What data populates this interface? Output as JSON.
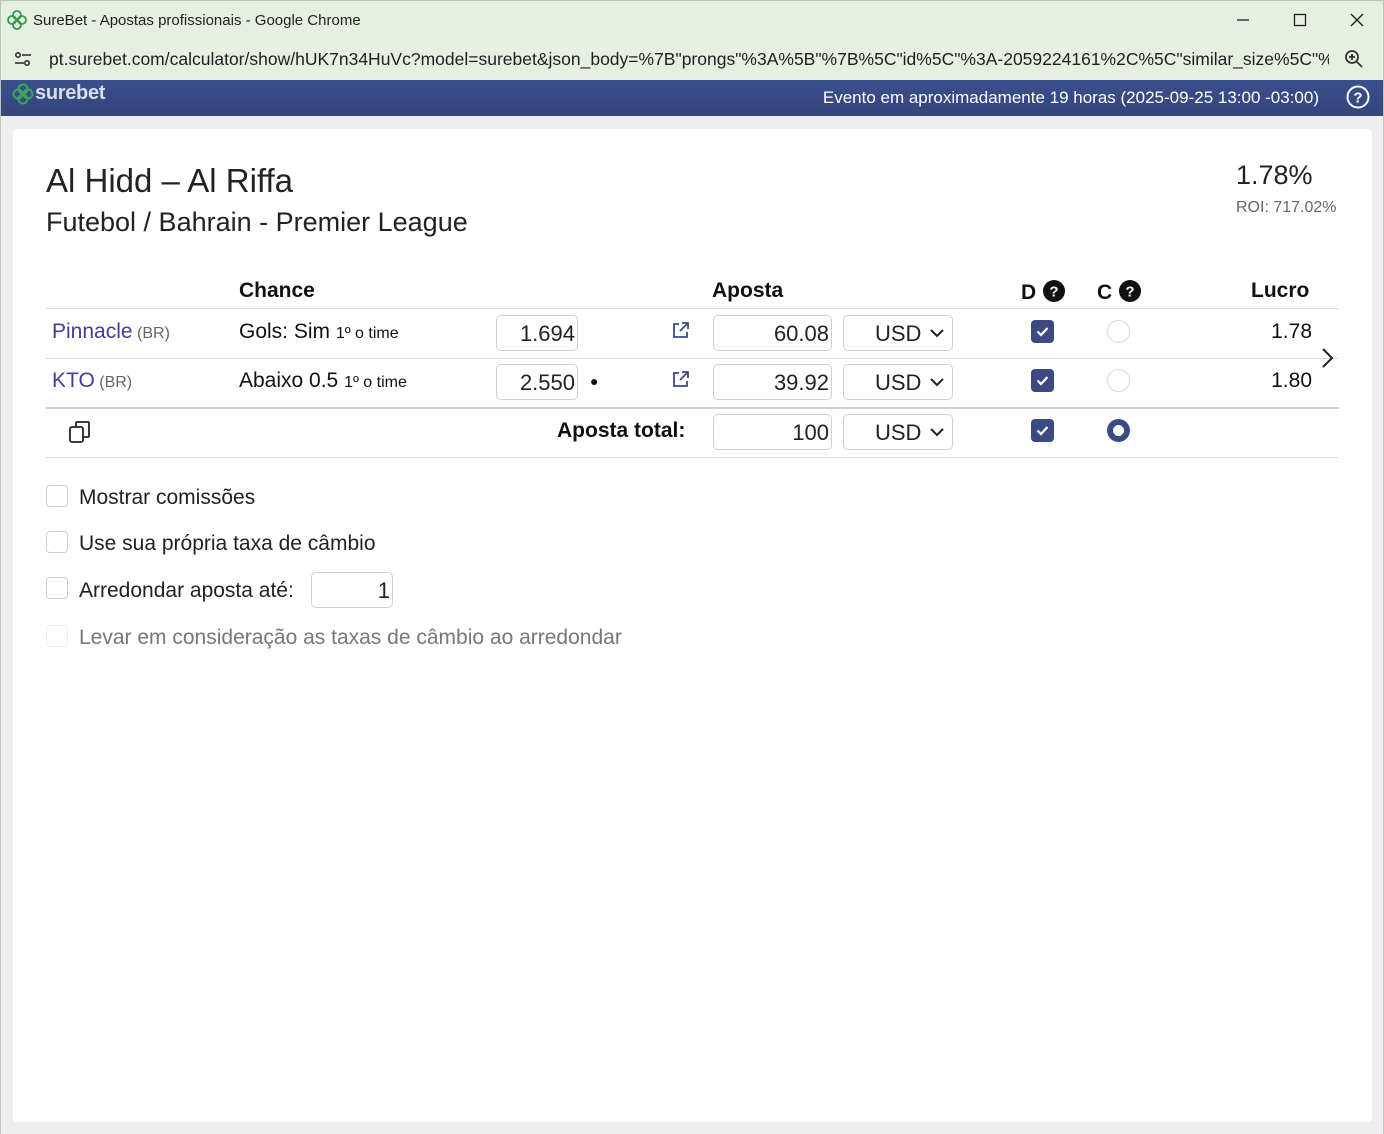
{
  "window": {
    "title": "SureBet - Apostas profissionais - Google Chrome",
    "url": "pt.surebet.com/calculator/show/hUK7n34HuVc?model=surebet&json_body=%7B\"prongs\"%3A%5B\"%7B%5C\"id%5C\"%3A-2059224161%2C%5C\"similar_size%5C\"%3..."
  },
  "header": {
    "logo_text": "surebet",
    "event_info": "Evento em aproximadamente 19 horas (2025-09-25 13:00 -03:00)"
  },
  "match": {
    "title": "Al Hidd – Al Riffa",
    "subtitle": "Futebol / Bahrain - Premier League",
    "profit_percent": "1.78%",
    "roi": "ROI: 717.02%"
  },
  "table": {
    "headers": {
      "chance": "Chance",
      "aposta": "Aposta",
      "d": "D",
      "c": "C",
      "lucro": "Lucro"
    },
    "rows": [
      {
        "bookmaker": "Pinnacle",
        "region": "(BR)",
        "outcome": "Gols: Sim",
        "period": "1º o time",
        "odds": "1.694",
        "stake": "60.08",
        "currency": "USD",
        "profit": "1.78",
        "d_checked": true,
        "c_selected": false
      },
      {
        "bookmaker": "KTO",
        "region": "(BR)",
        "outcome": "Abaixo 0.5",
        "period": "1º o time",
        "odds": "2.550",
        "odds_marker": "●",
        "stake": "39.92",
        "currency": "USD",
        "profit": "1.80",
        "d_checked": true,
        "c_selected": false
      }
    ],
    "total": {
      "label": "Aposta total:",
      "stake": "100",
      "currency": "USD",
      "d_checked": true,
      "c_selected": true
    }
  },
  "options": {
    "show_commissions": "Mostrar comissões",
    "own_exchange_rate": "Use sua própria taxa de câmbio",
    "round_stake": "Arredondar aposta até:",
    "round_value": "1",
    "consider_exchange": "Levar em consideração as taxas de câmbio ao arredondar"
  },
  "icons": {
    "favicon": "surebet-clover-icon",
    "site_info": "site-settings-icon",
    "zoom": "zoom-icon",
    "help": "help-icon",
    "external_link": "external-link-icon",
    "copy": "copy-icon",
    "next": "chevron-right-icon",
    "dropdown": "chevron-down-icon",
    "check": "check-icon"
  },
  "colors": {
    "header_bg": "#34457c",
    "accent": "#3b4a82",
    "bookmaker_link": "#4b3a93",
    "chrome_frame": "#e7efe3"
  }
}
